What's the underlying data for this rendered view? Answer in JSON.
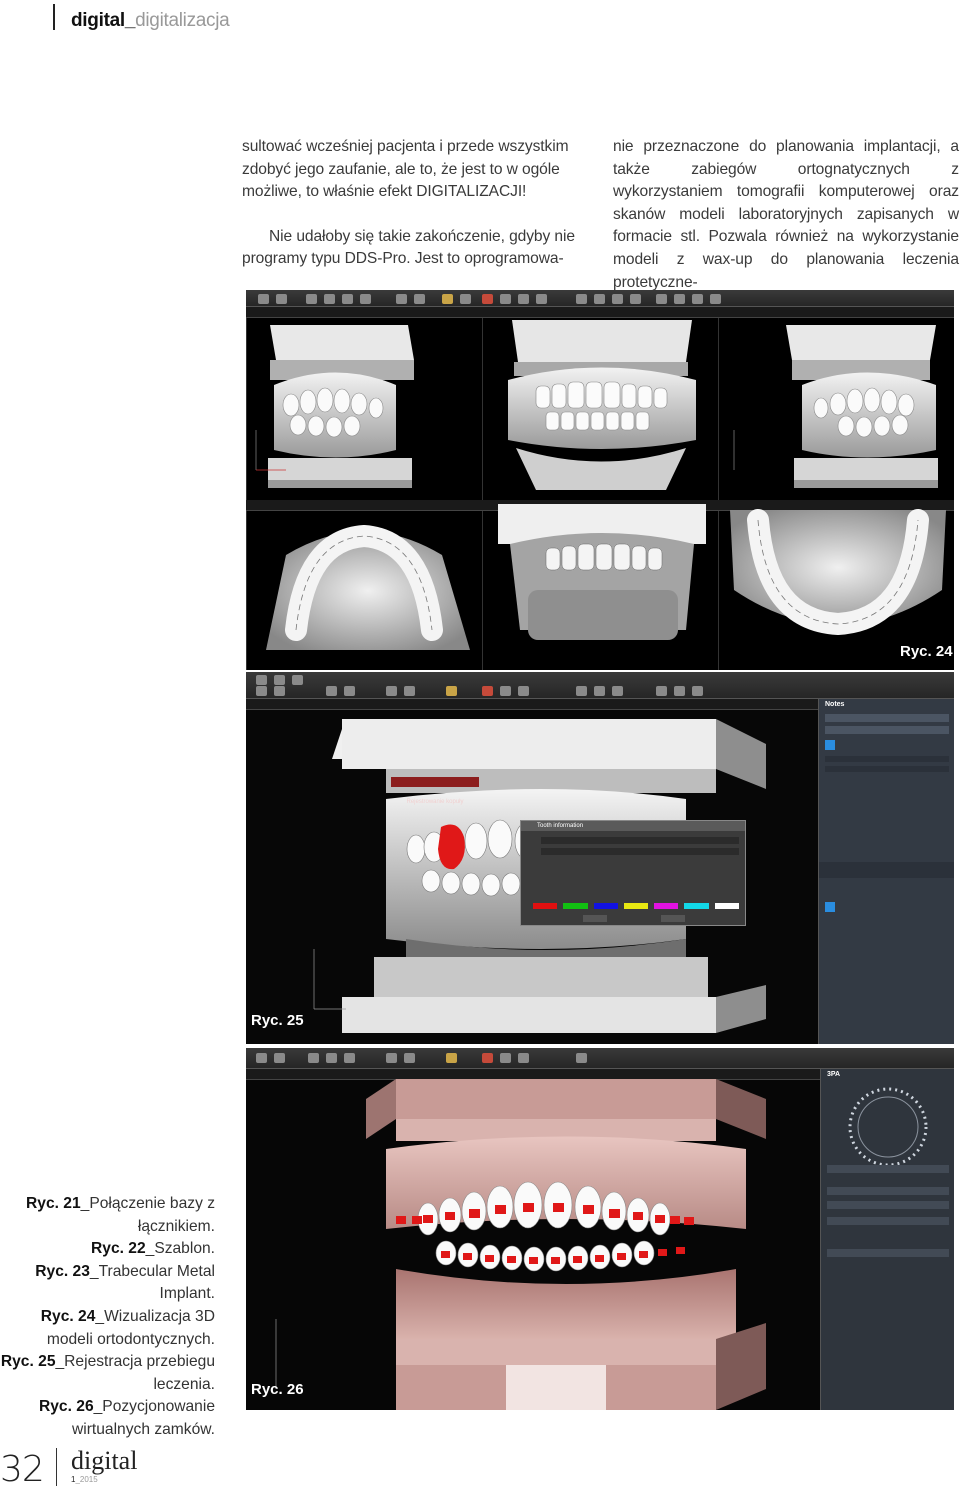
{
  "header": {
    "section_bold": "digital_",
    "section_light": "digitalizacja"
  },
  "text": {
    "col1_p1": "sultować wcześniej pacjenta i przede wszystkim zdobyć jego zaufanie, ale to, że jest to w ogóle możliwe, to właśnie efekt DIGITALIZACJI!",
    "col1_p2": "Nie udałoby się takie zakończenie, gdyby nie programy typu DDS-Pro. Jest to oprogramowa-",
    "col2_p1": "nie przeznaczone do planowania implantacji, a także zabiegów ortognatycznych z wykorzystaniem tomografii komputerowej oraz skanów modeli laboratoryjnych zapisanych w formacie stl. Pozwala również na wykorzystanie modeli z wax-up do planowania leczenia protetyczne-"
  },
  "figures": {
    "fig24_label": "Ryc. 24",
    "fig25_label": "Ryc. 25",
    "fig26_label": "Ryc. 26",
    "fig25_tag": "Rejestrowanie kopuły",
    "fig25_dialog_title": "Tooth information",
    "fig25_panel_title": "Notes",
    "fig26_panel_title": "3PA"
  },
  "caption": [
    {
      "bold": "Ryc. 21",
      "text": "_Połączenie bazy z łącznikiem."
    },
    {
      "bold": "Ryc. 22",
      "text": "_Szablon."
    },
    {
      "bold": "Ryc. 23",
      "text": "_Trabecular Metal Implant."
    },
    {
      "bold": "Ryc. 24",
      "text": "_Wizualizacja 3D modeli ortodontycznych."
    },
    {
      "bold": "Ryc. 25",
      "text": "_Rejestracja przebiegu leczenia."
    },
    {
      "bold": "Ryc. 26",
      "text": "_Pozycjonowanie wirtualnych zamków."
    }
  ],
  "footer": {
    "page_number": "32",
    "brand": "digital",
    "issue_num": "1",
    "issue_year": "_2015"
  },
  "colors": {
    "bracket_red": "#e01818",
    "gum_pink": "#c89b96",
    "model_gray": "#d8d8d8"
  }
}
